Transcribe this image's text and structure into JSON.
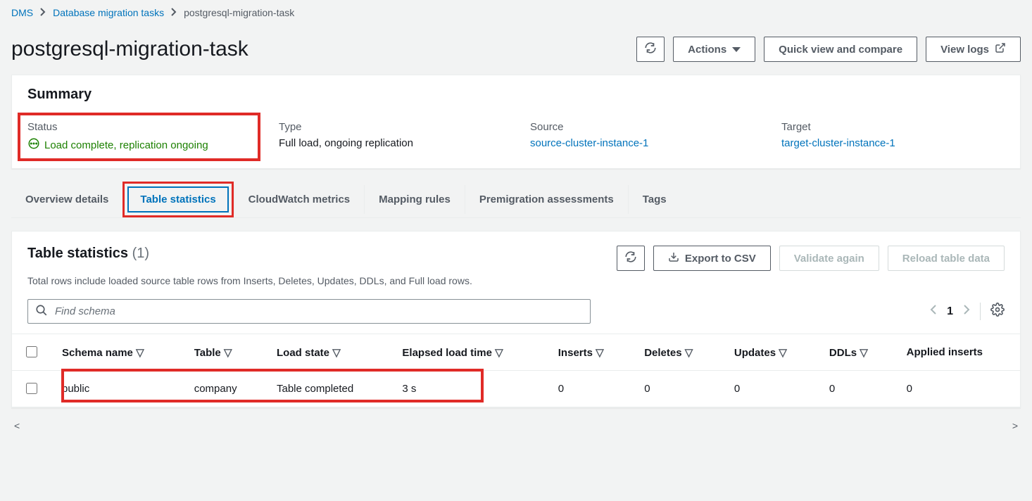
{
  "breadcrumb": {
    "root": "DMS",
    "mid": "Database migration tasks",
    "current": "postgresql-migration-task"
  },
  "page_title": "postgresql-migration-task",
  "header_actions": {
    "refresh_aria": "Refresh",
    "actions": "Actions",
    "quick_view": "Quick view and compare",
    "view_logs": "View logs"
  },
  "summary": {
    "heading": "Summary",
    "status_label": "Status",
    "status_value": "Load complete, replication ongoing",
    "type_label": "Type",
    "type_value": "Full load, ongoing replication",
    "source_label": "Source",
    "source_value": "source-cluster-instance-1",
    "target_label": "Target",
    "target_value": "target-cluster-instance-1"
  },
  "tabs": {
    "overview": "Overview details",
    "table_stats": "Table statistics",
    "cloudwatch": "CloudWatch metrics",
    "mapping": "Mapping rules",
    "premigration": "Premigration assessments",
    "tags": "Tags"
  },
  "stats": {
    "title": "Table statistics",
    "count": "(1)",
    "subtitle": "Total rows include loaded source table rows from Inserts, Deletes, Updates, DDLs, and Full load rows.",
    "refresh_aria": "Refresh",
    "export": "Export to CSV",
    "validate": "Validate again",
    "reload": "Reload table data",
    "search_placeholder": "Find schema",
    "page": "1"
  },
  "columns": {
    "schema": "Schema name",
    "table": "Table",
    "load_state": "Load state",
    "elapsed": "Elapsed load time",
    "inserts": "Inserts",
    "deletes": "Deletes",
    "updates": "Updates",
    "ddls": "DDLs",
    "applied_inserts": "Applied inserts"
  },
  "rows": [
    {
      "schema": "public",
      "table": "company",
      "load_state": "Table completed",
      "elapsed": "3 s",
      "inserts": "0",
      "deletes": "0",
      "updates": "0",
      "ddls": "0",
      "applied_inserts": "0"
    }
  ]
}
